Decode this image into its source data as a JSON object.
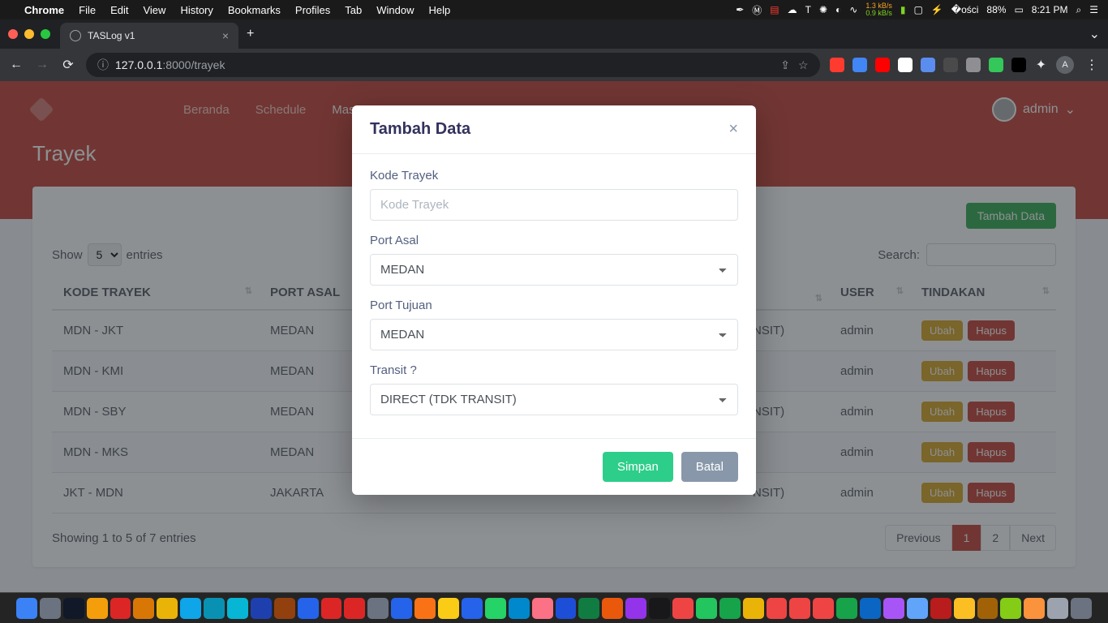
{
  "mac_menu": {
    "app": "Chrome",
    "items": [
      "File",
      "Edit",
      "View",
      "History",
      "Bookmarks",
      "Profiles",
      "Tab",
      "Window",
      "Help"
    ],
    "net_up": "1.3 kB/s",
    "net_down": "0.9 kB/s",
    "battery": "88%",
    "time": "8:21 PM"
  },
  "browser": {
    "tab_title": "TASLog v1",
    "url_host": "127.0.0.1",
    "url_port": ":8000",
    "url_path": "/trayek",
    "avatar_letter": "A"
  },
  "page": {
    "nav": {
      "items": [
        "Beranda",
        "Schedule",
        "Master"
      ],
      "user": "admin"
    },
    "title": "Trayek",
    "add_button": "Tambah Data",
    "table": {
      "show_label": "Show",
      "show_value": "5",
      "entries_label": "entries",
      "search_label": "Search:",
      "columns": [
        "KODE TRAYEK",
        "PORT ASAL",
        "USER",
        "TINDAKAN"
      ],
      "hidden_col_suffix": "NSIT)",
      "rows": [
        {
          "kode": "MDN - JKT",
          "asal": "MEDAN",
          "suffix": "NSIT)",
          "user": "admin"
        },
        {
          "kode": "MDN - KMI",
          "asal": "MEDAN",
          "suffix": "",
          "user": "admin"
        },
        {
          "kode": "MDN - SBY",
          "asal": "MEDAN",
          "suffix": "NSIT)",
          "user": "admin"
        },
        {
          "kode": "MDN - MKS",
          "asal": "MEDAN",
          "suffix": "",
          "user": "admin"
        },
        {
          "kode": "JKT - MDN",
          "asal": "JAKARTA",
          "suffix": "NSIT)",
          "user": "admin"
        }
      ],
      "action_edit": "Ubah",
      "action_delete": "Hapus",
      "footer_info": "Showing 1 to 5 of 7 entries",
      "pagination": {
        "prev": "Previous",
        "pages": [
          "1",
          "2"
        ],
        "active": "1",
        "next": "Next"
      }
    }
  },
  "modal": {
    "title": "Tambah Data",
    "fields": {
      "kode": {
        "label": "Kode Trayek",
        "placeholder": "Kode Trayek",
        "value": ""
      },
      "asal": {
        "label": "Port Asal",
        "value": "MEDAN"
      },
      "tujuan": {
        "label": "Port Tujuan",
        "value": "MEDAN"
      },
      "transit": {
        "label": "Transit ?",
        "value": "DIRECT (TDK TRANSIT)"
      }
    },
    "save": "Simpan",
    "cancel": "Batal"
  },
  "ext_colors": [
    "#ff3b30",
    "#4285f4",
    "#ff0000",
    "#ffffff",
    "#5b8def",
    "#4a4a4a",
    "#8e8e93",
    "#34c759",
    "#000000"
  ],
  "dock_colors": [
    "#3b82f6",
    "#6b7280",
    "#111827",
    "#f59e0b",
    "#dc2626",
    "#d97706",
    "#eab308",
    "#0ea5e9",
    "#0891b2",
    "#06b6d4",
    "#1e40af",
    "#92400e",
    "#2563eb",
    "#dc2626",
    "#dc2626",
    "#6b7280",
    "#2563eb",
    "#f97316",
    "#facc15",
    "#2563eb",
    "#25d366",
    "#0088cc",
    "#fb7185",
    "#1d4ed8",
    "#107c41",
    "#ea580c",
    "#9333ea",
    "#18181b",
    "#ef4444",
    "#22c55e",
    "#16a34a",
    "#eab308",
    "#ef4444",
    "#ef4444",
    "#ef4444",
    "#16a34a",
    "#0a66c2",
    "#a855f7",
    "#60a5fa",
    "#b91c1c",
    "#fbbf24",
    "#a16207",
    "#84cc16",
    "#fb923c",
    "#9ca3af",
    "#6b7280"
  ]
}
